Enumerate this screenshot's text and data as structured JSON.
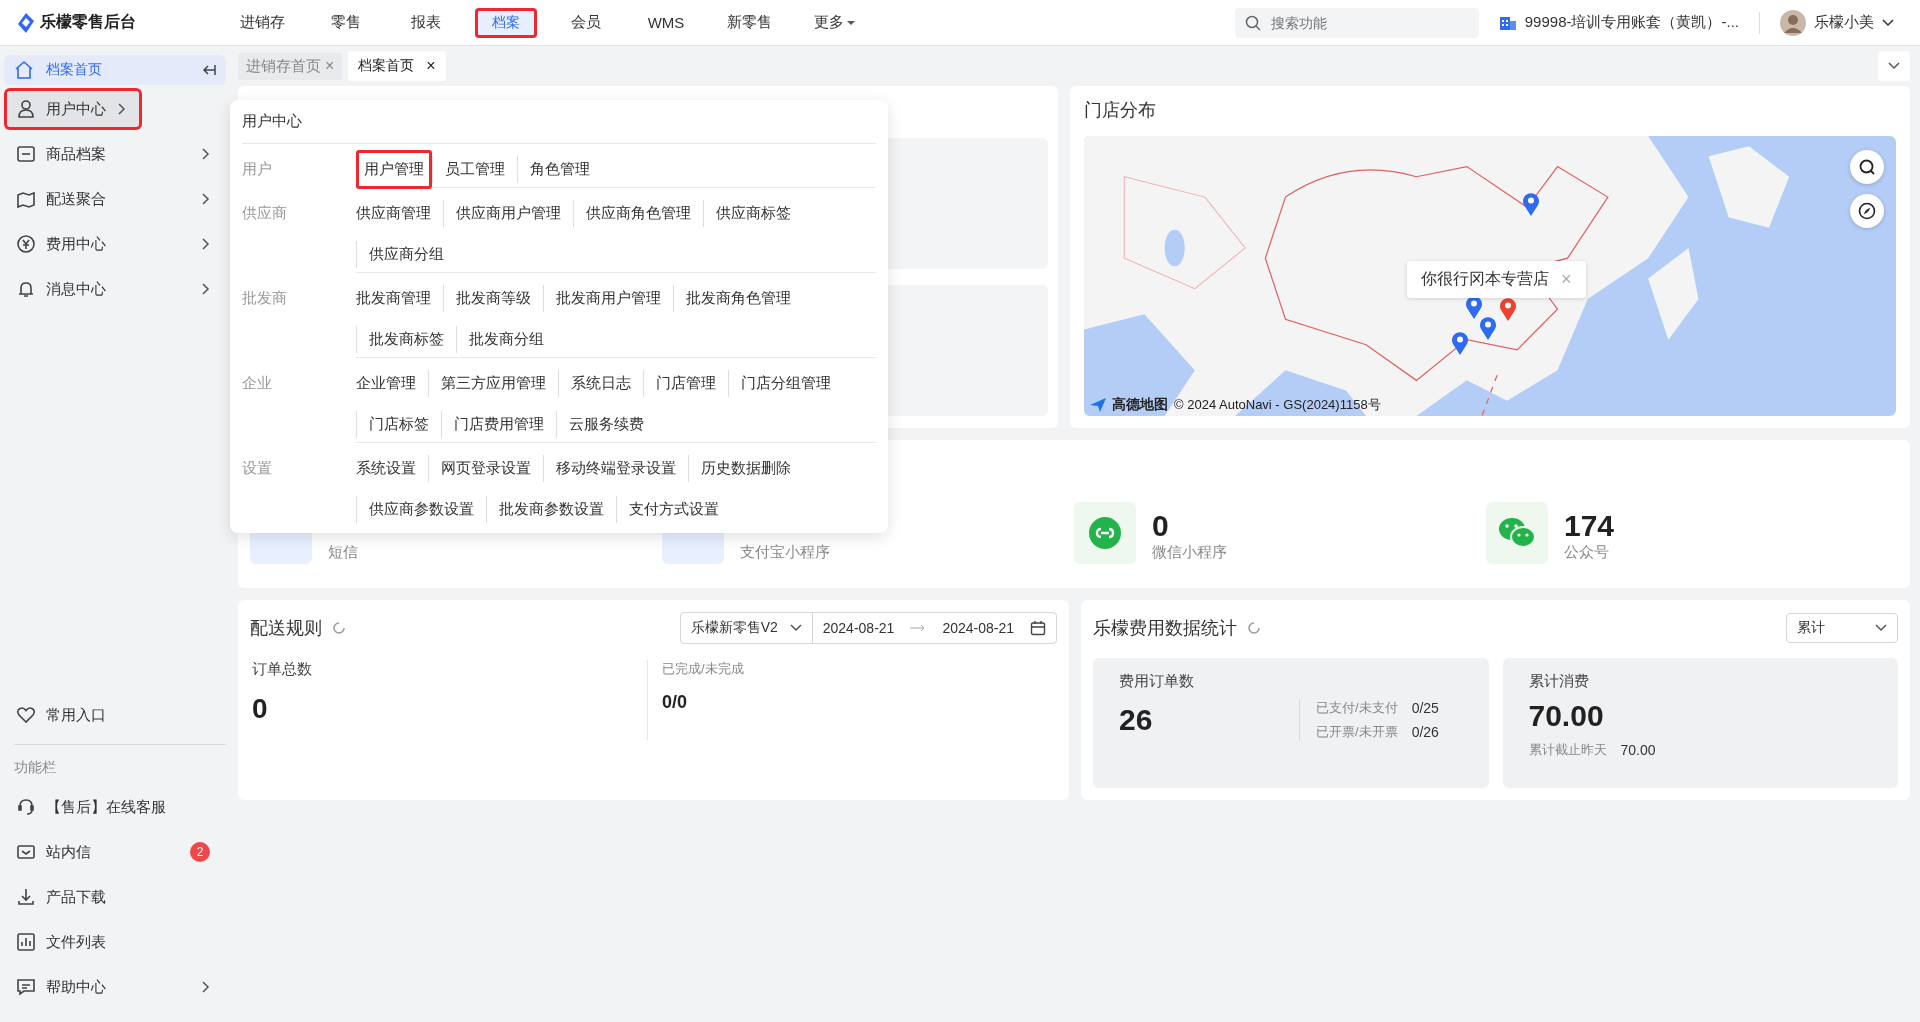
{
  "app": {
    "logo_text": "乐檬零售后台"
  },
  "top_nav": [
    {
      "label": "进销存",
      "selected": false,
      "highlighted": false
    },
    {
      "label": "零售",
      "selected": false,
      "highlighted": false
    },
    {
      "label": "报表",
      "selected": false,
      "highlighted": false
    },
    {
      "label": "档案",
      "selected": true,
      "highlighted": true
    },
    {
      "label": "会员",
      "selected": false,
      "highlighted": false
    },
    {
      "label": "WMS",
      "selected": false,
      "highlighted": false
    },
    {
      "label": "新零售",
      "selected": false,
      "highlighted": false
    },
    {
      "label": "更多",
      "selected": false,
      "highlighted": false,
      "has_menu": true
    }
  ],
  "search": {
    "placeholder": "搜索功能"
  },
  "account": "99998-培训专用账套（黄凯）-...",
  "user": {
    "name": "乐檬小美"
  },
  "sidebar": {
    "items": [
      {
        "label": "档案首页",
        "selected": true,
        "open": false,
        "highlighted": false,
        "has_submenu": false
      },
      {
        "label": "用户中心",
        "selected": false,
        "open": true,
        "highlighted": true,
        "has_submenu": true
      },
      {
        "label": "商品档案",
        "selected": false,
        "open": false,
        "highlighted": false,
        "has_submenu": true
      },
      {
        "label": "配送聚合",
        "selected": false,
        "open": false,
        "highlighted": false,
        "has_submenu": true
      },
      {
        "label": "费用中心",
        "selected": false,
        "open": false,
        "highlighted": false,
        "has_submenu": true
      },
      {
        "label": "消息中心",
        "selected": false,
        "open": false,
        "highlighted": false,
        "has_submenu": true
      }
    ],
    "favorites": "常用入口",
    "section_label": "功能栏",
    "tools": [
      {
        "label": "【售后】在线客服",
        "has_submenu": false
      },
      {
        "label": "站内信",
        "badge": "2",
        "has_submenu": false
      },
      {
        "label": "产品下载",
        "has_submenu": false
      },
      {
        "label": "文件列表",
        "has_submenu": false
      },
      {
        "label": "帮助中心",
        "has_submenu": true
      }
    ]
  },
  "tabs": [
    {
      "label": "进销存首页",
      "selected": false,
      "close": "×"
    },
    {
      "label": "档案首页",
      "selected": true,
      "close": "×"
    }
  ],
  "flyout": {
    "title": "用户中心",
    "groups": [
      {
        "label": "用户",
        "items": [
          {
            "label": "用户管理",
            "highlighted": true
          },
          {
            "label": "员工管理",
            "highlighted": false
          },
          {
            "label": "角色管理",
            "highlighted": false
          }
        ]
      },
      {
        "label": "供应商",
        "items": [
          {
            "label": "供应商管理",
            "highlighted": false
          },
          {
            "label": "供应商用户管理",
            "highlighted": false
          },
          {
            "label": "供应商角色管理",
            "highlighted": false
          },
          {
            "label": "供应商标签",
            "highlighted": false
          },
          {
            "label": "供应商分组",
            "highlighted": false
          }
        ]
      },
      {
        "label": "批发商",
        "items": [
          {
            "label": "批发商管理",
            "highlighted": false
          },
          {
            "label": "批发商等级",
            "highlighted": false
          },
          {
            "label": "批发商用户管理",
            "highlighted": false
          },
          {
            "label": "批发商角色管理",
            "highlighted": false
          },
          {
            "label": "批发商标签",
            "highlighted": false
          },
          {
            "label": "批发商分组",
            "highlighted": false
          }
        ]
      },
      {
        "label": "企业",
        "items": [
          {
            "label": "企业管理",
            "highlighted": false
          },
          {
            "label": "第三方应用管理",
            "highlighted": false
          },
          {
            "label": "系统日志",
            "highlighted": false
          },
          {
            "label": "门店管理",
            "highlighted": false
          },
          {
            "label": "门店分组管理",
            "highlighted": false
          },
          {
            "label": "门店标签",
            "highlighted": false
          },
          {
            "label": "门店费用管理",
            "highlighted": false
          },
          {
            "label": "云服务续费",
            "highlighted": false
          }
        ]
      },
      {
        "label": "设置",
        "items": [
          {
            "label": "系统设置",
            "highlighted": false
          },
          {
            "label": "网页登录设置",
            "highlighted": false
          },
          {
            "label": "移动终端登录设置",
            "highlighted": false
          },
          {
            "label": "历史数据删除",
            "highlighted": false
          },
          {
            "label": "供应商参数设置",
            "highlighted": false
          },
          {
            "label": "批发商参数设置",
            "highlighted": false
          },
          {
            "label": "支付方式设置",
            "highlighted": false
          }
        ]
      }
    ]
  },
  "store_map": {
    "title": "门店分布",
    "popup": {
      "text": "你很行冈本专营店",
      "close": "×"
    },
    "attribution_logo": "高德地图",
    "attribution": "© 2024 AutoNavi - GS(2024)1158号"
  },
  "channels": [
    {
      "label": "短信"
    },
    {
      "label": "支付宝小程序"
    },
    {
      "value": "0",
      "label": "微信小程序"
    },
    {
      "value": "174",
      "label": "公众号"
    }
  ],
  "delivery": {
    "title": "配送规则",
    "select": "乐檬新零售V2",
    "date_from": "2024-08-21",
    "date_to": "2024-08-21",
    "stats": [
      {
        "label": "订单总数",
        "value": "0"
      },
      {
        "label": "已完成/未完成",
        "value": "0/0"
      }
    ]
  },
  "fees": {
    "title": "乐檬费用数据统计",
    "select": "累计",
    "orders": {
      "label": "费用订单数",
      "value": "26",
      "details": [
        {
          "label": "已支付/未支付",
          "value": "0/25"
        },
        {
          "label": "已开票/未开票",
          "value": "0/26"
        }
      ]
    },
    "total": {
      "label": "累计消费",
      "value": "70.00",
      "note_label": "累计截止昨天",
      "note_value": "70.00"
    }
  }
}
